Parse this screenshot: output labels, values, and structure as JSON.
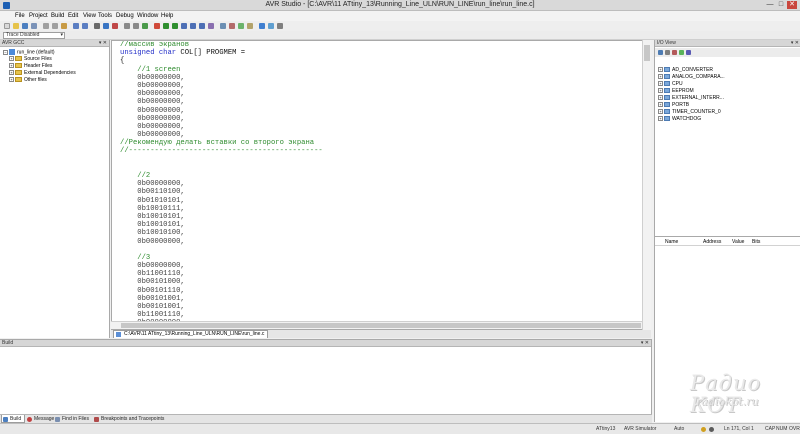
{
  "window": {
    "title": "AVR Studio - [C:\\AVR\\11 ATtiny_13\\Running_Line_ULN\\RUN_LINE\\run_line\\run_line.c]",
    "min_glyph": "—",
    "max_glyph": "□",
    "close_glyph": "✕"
  },
  "menu": [
    "File",
    "Project",
    "Build",
    "Edit",
    "View",
    "Tools",
    "Debug",
    "Window",
    "Help"
  ],
  "trace": {
    "value": "Trace Disabled"
  },
  "project_panel": {
    "header": "AVR GCC",
    "header_buttons": "▾ ✕",
    "root": "run_line (default)",
    "items": [
      "Source Files",
      "Header Files",
      "External Dependencies",
      "Other files"
    ]
  },
  "editor": {
    "lines": [
      {
        "t": "//массив экранов",
        "k": "comment",
        "indent": 0
      },
      {
        "t": "unsigned char COL[] PROGMEM =",
        "k": "decl",
        "indent": 0
      },
      {
        "t": "{",
        "k": "plain",
        "indent": 0
      },
      {
        "t": "//1 screen",
        "k": "comment",
        "indent": 1
      },
      {
        "t": "0b00000000,",
        "k": "number",
        "indent": 1
      },
      {
        "t": "0b00000000,",
        "k": "number",
        "indent": 1
      },
      {
        "t": "0b00000000,",
        "k": "number",
        "indent": 1
      },
      {
        "t": "0b00000000,",
        "k": "number",
        "indent": 1
      },
      {
        "t": "0b00000000,",
        "k": "number",
        "indent": 1
      },
      {
        "t": "0b00000000,",
        "k": "number",
        "indent": 1
      },
      {
        "t": "0b00000000,",
        "k": "number",
        "indent": 1
      },
      {
        "t": "0b00000000,",
        "k": "number",
        "indent": 1
      },
      {
        "t": "//Рекомендую делать вставки со второго экрана",
        "k": "comment",
        "indent": 0
      },
      {
        "t": "//---------------------------------------------",
        "k": "comment",
        "indent": 0
      },
      {
        "t": "",
        "k": "plain",
        "indent": 0
      },
      {
        "t": "",
        "k": "plain",
        "indent": 0
      },
      {
        "t": "//2",
        "k": "comment",
        "indent": 1
      },
      {
        "t": "0b00000000,",
        "k": "number",
        "indent": 1
      },
      {
        "t": "0b00110100,",
        "k": "number",
        "indent": 1
      },
      {
        "t": "0b01010101,",
        "k": "number",
        "indent": 1
      },
      {
        "t": "0b10010111,",
        "k": "number",
        "indent": 1
      },
      {
        "t": "0b10010101,",
        "k": "number",
        "indent": 1
      },
      {
        "t": "0b10010101,",
        "k": "number",
        "indent": 1
      },
      {
        "t": "0b10010100,",
        "k": "number",
        "indent": 1
      },
      {
        "t": "0b00000000,",
        "k": "number",
        "indent": 1
      },
      {
        "t": "",
        "k": "plain",
        "indent": 0
      },
      {
        "t": "//3",
        "k": "comment",
        "indent": 1
      },
      {
        "t": "0b00000000,",
        "k": "number",
        "indent": 1
      },
      {
        "t": "0b11001110,",
        "k": "number",
        "indent": 1
      },
      {
        "t": "0b00101000,",
        "k": "number",
        "indent": 1
      },
      {
        "t": "0b00101110,",
        "k": "number",
        "indent": 1
      },
      {
        "t": "0b00101001,",
        "k": "number",
        "indent": 1
      },
      {
        "t": "0b00101001,",
        "k": "number",
        "indent": 1
      },
      {
        "t": "0b11001110,",
        "k": "number",
        "indent": 1
      },
      {
        "t": "0b00000000,",
        "k": "number",
        "indent": 1
      }
    ]
  },
  "doc_tab": {
    "label": "C:\\AVR\\11 ATtiny_13\\Running_Line_ULN\\RUN_LINE\\run_line.c"
  },
  "io_panel": {
    "header": "I/O View",
    "header_buttons": "▾ ✕",
    "items": [
      "AD_CONVERTER",
      "ANALOG_COMPARA...",
      "CPU",
      "EEPROM",
      "EXTERNAL_INTERR...",
      "PORTB",
      "TIMER_COUNTER_0",
      "WATCHDOG"
    ]
  },
  "register_panel": {
    "columns": [
      "Name",
      "Address",
      "Value",
      "Bits"
    ]
  },
  "build_panel": {
    "header": "Build",
    "header_buttons": "▾ ✕"
  },
  "output_tabs": [
    "Build",
    "Message",
    "Find in Files",
    "Breakpoints and Tracepoints"
  ],
  "status": {
    "device": "ATtiny13",
    "platform": "AVR Simulator",
    "mode": "Auto",
    "position": "Ln 171, Col 1",
    "caps": "CAP",
    "num": "NUM",
    "ovr": "OVR"
  },
  "watermark": {
    "line1": "Радио КОТ",
    "line2": "radiokot.ru"
  },
  "colors": {
    "comment": "#2e8b2e",
    "keyword": "#2430c8",
    "accent": "#1c5fb3"
  }
}
